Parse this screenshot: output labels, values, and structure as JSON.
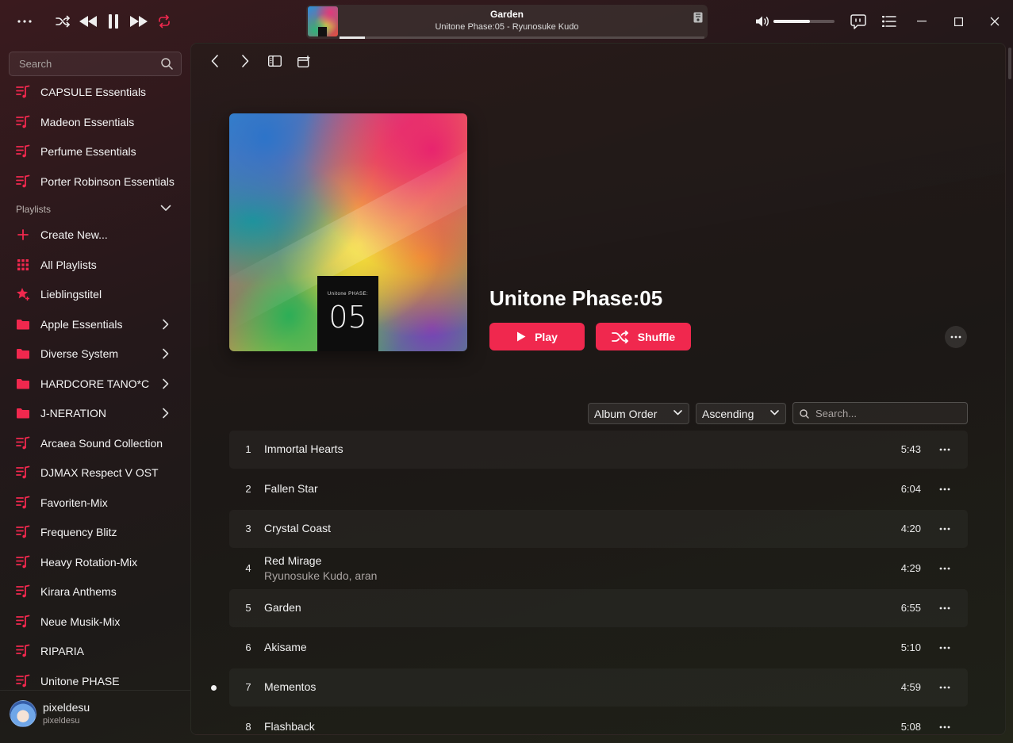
{
  "colors": {
    "accent": "#f0284e",
    "text": "#f2f2f2",
    "muted": "#a9a3a1"
  },
  "topbar": {
    "now_playing": {
      "title": "Garden",
      "subtitle": "Unitone Phase:05 - Ryunosuke Kudo",
      "progress": 0.07,
      "art_label": "05"
    },
    "volume": 0.6
  },
  "sidebar": {
    "search_placeholder": "Search",
    "top_items": [
      {
        "label": "CAPSULE Essentials",
        "icon": "playlist-music-icon"
      },
      {
        "label": "Madeon Essentials",
        "icon": "playlist-music-icon"
      },
      {
        "label": "Perfume Essentials",
        "icon": "playlist-music-icon"
      },
      {
        "label": "Porter Robinson Essentials",
        "icon": "playlist-music-icon"
      }
    ],
    "playlists_header": "Playlists",
    "playlist_items": [
      {
        "label": "Create New...",
        "icon": "plus-icon",
        "has_chevron": false
      },
      {
        "label": "All Playlists",
        "icon": "grid-icon",
        "has_chevron": false
      },
      {
        "label": "Lieblingstitel",
        "icon": "star-icon",
        "has_chevron": false
      },
      {
        "label": "Apple Essentials",
        "icon": "folder-icon",
        "has_chevron": true
      },
      {
        "label": "Diverse System",
        "icon": "folder-icon",
        "has_chevron": true
      },
      {
        "label": "HARDCORE TANO*C",
        "icon": "folder-icon",
        "has_chevron": true
      },
      {
        "label": "J-NERATION",
        "icon": "folder-icon",
        "has_chevron": true
      },
      {
        "label": "Arcaea Sound Collection",
        "icon": "playlist-music-icon",
        "has_chevron": false
      },
      {
        "label": "DJMAX Respect V OST",
        "icon": "playlist-music-icon",
        "has_chevron": false
      },
      {
        "label": "Favoriten-Mix",
        "icon": "playlist-music-icon",
        "has_chevron": false
      },
      {
        "label": "Frequency Blitz",
        "icon": "playlist-music-icon",
        "has_chevron": false
      },
      {
        "label": "Heavy Rotation-Mix",
        "icon": "playlist-music-icon",
        "has_chevron": false
      },
      {
        "label": "Kirara Anthems",
        "icon": "playlist-music-icon",
        "has_chevron": false
      },
      {
        "label": "Neue Musik-Mix",
        "icon": "playlist-music-icon",
        "has_chevron": false
      },
      {
        "label": "RIPARIA",
        "icon": "playlist-music-icon",
        "has_chevron": false
      },
      {
        "label": "Unitone PHASE",
        "icon": "playlist-music-icon",
        "has_chevron": false
      }
    ],
    "user": {
      "name": "pixeldesu",
      "handle": "pixeldesu"
    }
  },
  "album": {
    "title": "Unitone Phase:05",
    "cover_small_text": "Unitone PHASE:",
    "cover_number": "05",
    "play_label": "Play",
    "shuffle_label": "Shuffle"
  },
  "filters": {
    "sort_order": "Album Order",
    "sort_direction": "Ascending",
    "search_placeholder": "Search..."
  },
  "tracks": [
    {
      "num": "1",
      "title": "Immortal Hearts",
      "artist": "",
      "duration": "5:43",
      "playing": false
    },
    {
      "num": "2",
      "title": "Fallen Star",
      "artist": "",
      "duration": "6:04",
      "playing": false
    },
    {
      "num": "3",
      "title": "Crystal Coast",
      "artist": "",
      "duration": "4:20",
      "playing": false
    },
    {
      "num": "4",
      "title": "Red Mirage",
      "artist": "Ryunosuke Kudo, aran",
      "duration": "4:29",
      "playing": false
    },
    {
      "num": "5",
      "title": "Garden",
      "artist": "",
      "duration": "6:55",
      "playing": false
    },
    {
      "num": "6",
      "title": "Akisame",
      "artist": "",
      "duration": "5:10",
      "playing": false
    },
    {
      "num": "7",
      "title": "Mementos",
      "artist": "",
      "duration": "4:59",
      "playing": true
    },
    {
      "num": "8",
      "title": "Flashback",
      "artist": "",
      "duration": "5:08",
      "playing": false
    }
  ]
}
